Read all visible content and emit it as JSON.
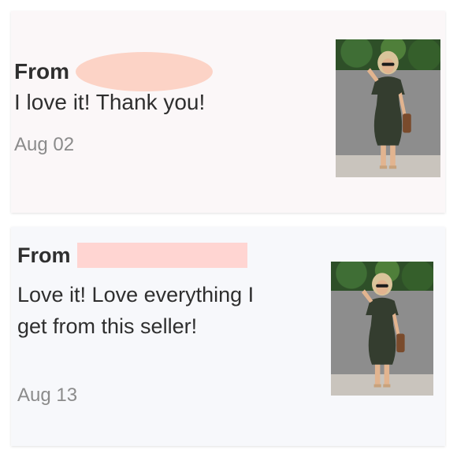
{
  "reviews": [
    {
      "from_label": "From",
      "text": "I love it! Thank you!",
      "date": "Aug 02"
    },
    {
      "from_label": "From",
      "text": "Love it! Love everything I get from this seller!",
      "date": "Aug 13"
    }
  ],
  "colors": {
    "card1_bg": "#fbf7f8",
    "card2_bg": "#f7f8fb",
    "redaction_1": "#fcd3c6",
    "redaction_2": "#ffd5d2",
    "text": "#2f2f2f",
    "date_text": "#8b8b8b"
  },
  "icons": {
    "product_photo": "product-photo-green-dress"
  }
}
